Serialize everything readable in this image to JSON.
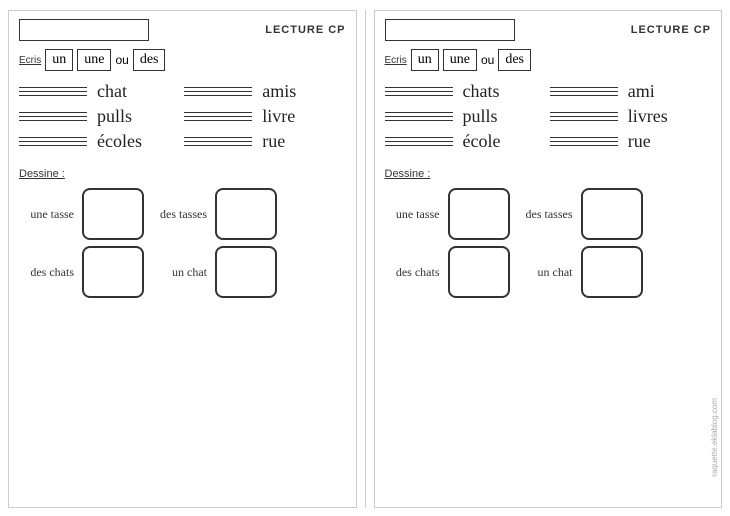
{
  "panels": [
    {
      "id": "left",
      "title_input": "",
      "lecture_label": "LECTURE CP",
      "ecris_label": "Ecris",
      "words_ecris": [
        "un",
        "une",
        "ou",
        "des"
      ],
      "words": [
        {
          "lines": 3,
          "word": "chat"
        },
        {
          "lines": 3,
          "word": "amis"
        },
        {
          "lines": 3,
          "word": "pulls"
        },
        {
          "lines": 3,
          "word": "livre"
        },
        {
          "lines": 3,
          "word": "écoles"
        },
        {
          "lines": 3,
          "word": "rue"
        }
      ],
      "dessine_label": "Dessine :",
      "dessine_rows": [
        {
          "left_text": "une tasse",
          "right_text": "des tasses"
        },
        {
          "left_text": "des chats",
          "right_text": "un chat"
        }
      ]
    },
    {
      "id": "right",
      "title_input": "",
      "lecture_label": "LECTURE CP",
      "ecris_label": "Ecris",
      "words_ecris": [
        "un",
        "une",
        "ou",
        "des"
      ],
      "words": [
        {
          "lines": 3,
          "word": "chats"
        },
        {
          "lines": 3,
          "word": "ami"
        },
        {
          "lines": 3,
          "word": "pulls"
        },
        {
          "lines": 3,
          "word": "livres"
        },
        {
          "lines": 3,
          "word": "école"
        },
        {
          "lines": 3,
          "word": "rue"
        }
      ],
      "dessine_label": "Dessine :",
      "dessine_rows": [
        {
          "left_text": "une tasse",
          "right_text": "des tasses"
        },
        {
          "left_text": "des chats",
          "right_text": "un chat"
        }
      ]
    }
  ],
  "watermark": "raquette.eklablog.com"
}
